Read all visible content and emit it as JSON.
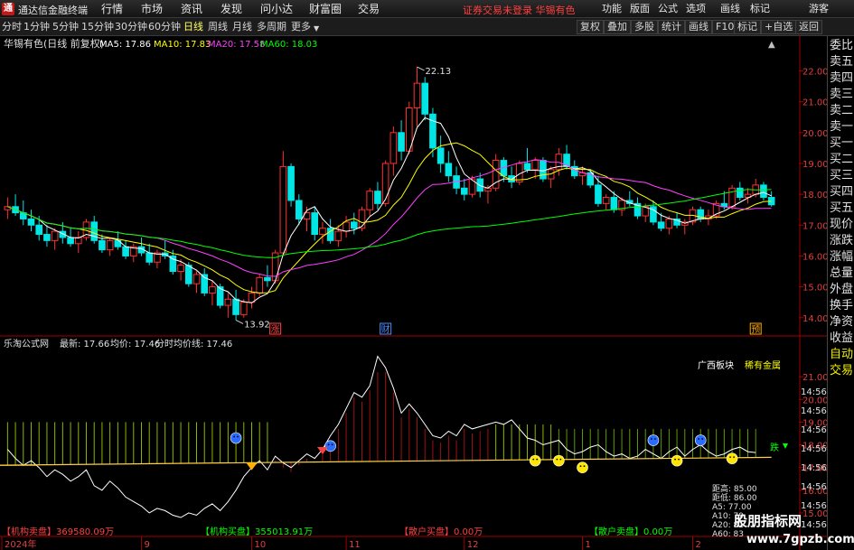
{
  "app": {
    "logo_char": "通",
    "title": "通达信金融终端"
  },
  "menu": [
    "行情",
    "市场",
    "资讯",
    "发现",
    "问小达",
    "财富圈",
    "交易"
  ],
  "notice": "证券交易未登录  华锡有色",
  "menu_right": [
    "功能",
    "版面",
    "公式",
    "选项",
    "画线",
    "标记",
    "游客"
  ],
  "toolbar": {
    "periods": [
      "分时",
      "1分钟",
      "5分钟",
      "15分钟",
      "30分钟",
      "60分钟",
      "日线",
      "周线",
      "月线",
      "多周期",
      "更多"
    ],
    "active": "日线",
    "buttons": [
      "复权",
      "叠加",
      "多股",
      "统计",
      "画线",
      "F10",
      "标记",
      "+自选",
      "返回"
    ]
  },
  "main_chart": {
    "stock_title": "华锡有色(日线 前复权)",
    "ma_legend": [
      {
        "label": "MA5: 17.86",
        "color": "#ffffff"
      },
      {
        "label": "MA10: 17.83",
        "color": "#ffff00"
      },
      {
        "label": "MA20: 17.58",
        "color": "#ff40ff"
      },
      {
        "label": "MA60: 18.03",
        "color": "#00ff00"
      }
    ],
    "price_ticks": [
      "22.00",
      "21.00",
      "20.00",
      "19.00",
      "18.00",
      "17.00",
      "16.00",
      "15.00",
      "14.00"
    ],
    "price_range": [
      13.7,
      22.6
    ],
    "high_label": "22.13",
    "low_label": "13.92",
    "events": [
      {
        "label": "涨",
        "color": "#ff4444"
      },
      {
        "label": "财",
        "color": "#4a8cff"
      },
      {
        "label": "预",
        "color": "#ffaa00"
      }
    ]
  },
  "indicator": {
    "title": "乐淘公式网",
    "latest": "最新: 17.66",
    "avg": "均价: 17.46",
    "avg_line": "分时均价线: 17.46",
    "sector_labels": [
      "广西板块",
      "稀有金属"
    ],
    "ticks": [
      "21.00",
      "20.00",
      "19.00",
      "18.00",
      "17.00",
      "16.00",
      "15.00"
    ],
    "range": [
      14.6,
      22.0
    ],
    "bottom_labels": [
      {
        "text": "【机构卖盘】369580.09万",
        "color": "#ff4040"
      },
      {
        "text": "【机构买盘】355013.91万",
        "color": "#00ff00"
      },
      {
        "text": "【散户买盘】0.00万",
        "color": "#ff4040"
      },
      {
        "text": "【散户卖盘】0.00万",
        "color": "#00ff00"
      }
    ],
    "stats": [
      "距高: 85.00",
      "距低: 86.00",
      "A5: 77.00",
      "A10: 79",
      "A20: 81",
      "A60: 83"
    ],
    "marker_label": "跌"
  },
  "right_ticks": [
    "14:56",
    "14:56",
    "14:56",
    "14:56",
    "14:56",
    "14:56",
    "14:56",
    "14:56"
  ],
  "x_axis": [
    "2024年",
    "9",
    "10",
    "11",
    "12",
    "1",
    "2"
  ],
  "right_panel": [
    "委比",
    "卖五",
    "卖四",
    "卖三",
    "卖二",
    "卖一",
    "买一",
    "买二",
    "买三",
    "买四",
    "买五",
    "现价",
    "涨跌",
    "涨幅",
    "总量",
    "外盘",
    "换手",
    "净资",
    "收益",
    "自动",
    "交易"
  ],
  "watermark": {
    "text": "股朋指标网",
    "url": "www.7gpzb.com"
  },
  "chart_data": {
    "type": "candlestick",
    "title": "华锡有色(日线 前复权)",
    "ohlc": [
      [
        17.5,
        17.9,
        17.2,
        17.6
      ],
      [
        17.6,
        18.0,
        17.3,
        17.4
      ],
      [
        17.4,
        17.8,
        17.0,
        17.2
      ],
      [
        17.2,
        17.5,
        16.8,
        17.0
      ],
      [
        17.0,
        17.3,
        16.5,
        16.7
      ],
      [
        16.7,
        17.0,
        16.3,
        16.5
      ],
      [
        16.5,
        16.9,
        16.2,
        16.8
      ],
      [
        16.8,
        17.1,
        16.4,
        16.6
      ],
      [
        16.6,
        16.9,
        16.3,
        16.4
      ],
      [
        16.4,
        16.8,
        16.1,
        16.6
      ],
      [
        16.6,
        17.2,
        16.5,
        17.1
      ],
      [
        17.1,
        17.3,
        16.4,
        16.5
      ],
      [
        16.5,
        16.7,
        16.1,
        16.2
      ],
      [
        16.2,
        16.6,
        16.0,
        16.5
      ],
      [
        16.5,
        16.8,
        16.2,
        16.3
      ],
      [
        16.3,
        16.5,
        15.9,
        16.0
      ],
      [
        16.0,
        16.4,
        15.8,
        16.3
      ],
      [
        16.3,
        16.6,
        16.0,
        16.1
      ],
      [
        16.1,
        16.4,
        15.7,
        15.8
      ],
      [
        15.8,
        16.2,
        15.6,
        16.1
      ],
      [
        16.1,
        16.5,
        15.9,
        16.0
      ],
      [
        16.0,
        16.2,
        15.4,
        15.5
      ],
      [
        15.5,
        15.9,
        15.2,
        15.7
      ],
      [
        15.7,
        15.8,
        15.0,
        15.1
      ],
      [
        15.1,
        15.5,
        14.8,
        15.4
      ],
      [
        15.4,
        15.6,
        14.7,
        14.8
      ],
      [
        14.8,
        15.2,
        14.4,
        15.0
      ],
      [
        15.0,
        15.1,
        14.3,
        14.4
      ],
      [
        14.4,
        14.8,
        14.0,
        14.6
      ],
      [
        14.6,
        14.9,
        13.92,
        14.1
      ],
      [
        14.1,
        14.6,
        14.0,
        14.5
      ],
      [
        14.5,
        15.0,
        14.3,
        14.8
      ],
      [
        14.8,
        15.4,
        14.7,
        15.3
      ],
      [
        15.3,
        15.7,
        15.0,
        15.2
      ],
      [
        15.2,
        16.2,
        15.1,
        16.1
      ],
      [
        16.1,
        19.4,
        16.0,
        18.9
      ],
      [
        18.9,
        19.0,
        17.6,
        17.8
      ],
      [
        17.8,
        18.0,
        17.0,
        17.2
      ],
      [
        17.2,
        17.6,
        16.8,
        17.4
      ],
      [
        17.4,
        17.6,
        16.5,
        16.7
      ],
      [
        16.7,
        17.1,
        16.4,
        16.9
      ],
      [
        16.9,
        17.2,
        16.4,
        16.5
      ],
      [
        16.5,
        17.0,
        16.3,
        16.8
      ],
      [
        16.8,
        17.3,
        16.6,
        17.1
      ],
      [
        17.1,
        17.4,
        16.7,
        16.9
      ],
      [
        16.9,
        17.6,
        16.8,
        17.5
      ],
      [
        17.5,
        18.2,
        17.3,
        18.1
      ],
      [
        18.1,
        18.4,
        17.5,
        17.7
      ],
      [
        17.7,
        19.1,
        17.6,
        19.0
      ],
      [
        19.0,
        20.2,
        18.6,
        20.0
      ],
      [
        20.0,
        20.4,
        19.1,
        19.4
      ],
      [
        19.4,
        21.0,
        19.3,
        20.8
      ],
      [
        20.8,
        22.13,
        20.2,
        21.6
      ],
      [
        21.6,
        21.8,
        20.4,
        20.6
      ],
      [
        20.6,
        20.8,
        19.2,
        19.5
      ],
      [
        19.5,
        19.9,
        18.7,
        19.0
      ],
      [
        19.0,
        19.4,
        18.4,
        18.6
      ],
      [
        18.6,
        18.9,
        18.0,
        18.2
      ],
      [
        18.2,
        18.5,
        17.8,
        18.0
      ],
      [
        18.0,
        18.6,
        17.9,
        18.5
      ],
      [
        18.5,
        18.7,
        17.9,
        18.1
      ],
      [
        18.1,
        18.3,
        17.7,
        18.2
      ],
      [
        18.2,
        19.3,
        18.1,
        19.1
      ],
      [
        19.1,
        19.2,
        18.4,
        18.6
      ],
      [
        18.6,
        18.9,
        18.2,
        18.4
      ],
      [
        18.4,
        19.1,
        18.3,
        19.0
      ],
      [
        19.0,
        19.5,
        18.7,
        18.8
      ],
      [
        18.8,
        19.2,
        18.5,
        19.1
      ],
      [
        19.1,
        19.2,
        18.4,
        18.5
      ],
      [
        18.5,
        18.9,
        18.2,
        18.8
      ],
      [
        18.8,
        19.5,
        18.6,
        19.3
      ],
      [
        19.3,
        19.6,
        18.8,
        18.9
      ],
      [
        18.9,
        19.1,
        18.5,
        18.6
      ],
      [
        18.6,
        18.9,
        18.3,
        18.7
      ],
      [
        18.7,
        18.8,
        18.2,
        18.3
      ],
      [
        18.3,
        18.6,
        17.6,
        17.7
      ],
      [
        17.7,
        18.0,
        17.5,
        17.9
      ],
      [
        17.9,
        18.1,
        17.4,
        17.5
      ],
      [
        17.5,
        17.9,
        17.3,
        17.8
      ],
      [
        17.8,
        18.1,
        17.6,
        17.7
      ],
      [
        17.7,
        17.9,
        17.2,
        17.3
      ],
      [
        17.3,
        17.7,
        17.1,
        17.6
      ],
      [
        17.6,
        17.8,
        17.0,
        17.1
      ],
      [
        17.1,
        17.4,
        16.8,
        16.9
      ],
      [
        16.9,
        17.3,
        16.7,
        17.2
      ],
      [
        17.2,
        17.4,
        16.9,
        17.0
      ],
      [
        17.0,
        17.2,
        16.7,
        17.1
      ],
      [
        17.1,
        17.6,
        17.0,
        17.5
      ],
      [
        17.5,
        17.6,
        17.1,
        17.2
      ],
      [
        17.2,
        17.5,
        17.0,
        17.3
      ],
      [
        17.3,
        17.8,
        17.2,
        17.7
      ],
      [
        17.7,
        18.1,
        17.5,
        17.6
      ],
      [
        17.6,
        18.3,
        17.5,
        18.2
      ],
      [
        18.2,
        18.4,
        17.8,
        17.9
      ],
      [
        17.9,
        18.2,
        17.7,
        18.0
      ],
      [
        18.0,
        18.5,
        17.9,
        18.3
      ],
      [
        18.3,
        18.4,
        17.8,
        17.9
      ],
      [
        17.9,
        18.1,
        17.6,
        17.66
      ]
    ],
    "ma_windows": [
      5,
      10,
      20,
      60
    ],
    "indicator_line": [
      17.8,
      17.4,
      17.1,
      17.3,
      17.0,
      16.6,
      16.9,
      16.7,
      16.4,
      16.6,
      16.9,
      16.2,
      16.0,
      16.4,
      16.1,
      15.7,
      15.5,
      15.3,
      15.0,
      15.2,
      15.1,
      14.9,
      14.8,
      15.0,
      14.9,
      15.2,
      15.4,
      15.1,
      15.5,
      16.0,
      16.6,
      17.0,
      17.3,
      16.9,
      17.5,
      17.2,
      17.0,
      17.3,
      17.6,
      17.4,
      17.8,
      18.4,
      18.9,
      19.6,
      20.3,
      20.1,
      20.6,
      21.9,
      21.4,
      20.5,
      19.4,
      19.8,
      19.4,
      18.9,
      18.4,
      18.3,
      18.6,
      18.4,
      18.9,
      18.7,
      18.8,
      18.9,
      19.0,
      18.9,
      19.1,
      18.7,
      18.3,
      18.2,
      18.0,
      18.1,
      18.2,
      17.8,
      17.6,
      17.7,
      17.9,
      18.0,
      17.7,
      17.5,
      17.6,
      17.4,
      17.5,
      17.8,
      17.6,
      17.4,
      17.7,
      17.9,
      17.5,
      17.8,
      18.0,
      17.7,
      17.5,
      17.6,
      17.8,
      17.9,
      17.7,
      17.66
    ],
    "avg_line": [
      17.1,
      17.45
    ]
  }
}
